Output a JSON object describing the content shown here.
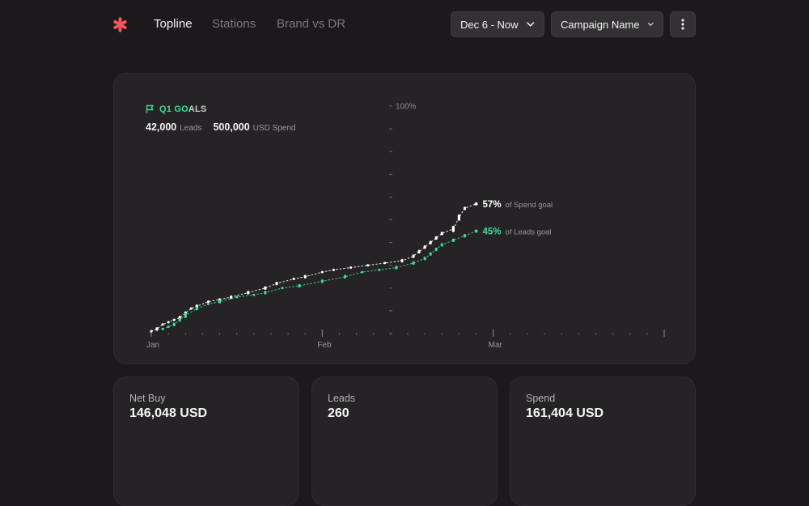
{
  "nav": {
    "tabs": [
      {
        "label": "Topline",
        "active": true
      },
      {
        "label": "Stations",
        "active": false
      },
      {
        "label": "Brand vs DR",
        "active": false
      }
    ],
    "date_range": "Dec 6 - Now",
    "campaign": "Campaign Name"
  },
  "colors": {
    "accent_red": "#f0565d",
    "leads_green": "#3ddc97",
    "spend_white": "#ffffff"
  },
  "goals": {
    "title_a": "Q1 GO",
    "title_b": "ALS",
    "leads_value": "42,000",
    "leads_unit": "Leads",
    "spend_value": "500,000",
    "spend_unit": "USD Spend"
  },
  "chart_data": {
    "type": "line",
    "title": "",
    "x_tick_labels": [
      "Jan",
      "Feb",
      "Mar"
    ],
    "y_tick_top_label": "100%",
    "ylim": [
      0,
      100
    ],
    "x_domain_days": [
      0,
      90
    ],
    "series": [
      {
        "key": "spend",
        "color": "#ffffff",
        "end_value_label": "57%",
        "end_text": "of Spend goal",
        "points": [
          [
            0,
            1
          ],
          [
            1,
            2
          ],
          [
            2,
            4
          ],
          [
            3,
            5
          ],
          [
            4,
            6
          ],
          [
            5,
            7
          ],
          [
            6,
            9
          ],
          [
            7,
            11
          ],
          [
            8,
            12
          ],
          [
            10,
            14
          ],
          [
            12,
            15
          ],
          [
            14,
            16
          ],
          [
            17,
            18
          ],
          [
            20,
            20
          ],
          [
            22,
            22
          ],
          [
            25,
            24
          ],
          [
            27,
            25
          ],
          [
            30,
            27
          ],
          [
            32,
            28
          ],
          [
            35,
            29
          ],
          [
            38,
            30
          ],
          [
            41,
            31
          ],
          [
            44,
            32
          ],
          [
            46,
            34
          ],
          [
            47,
            36
          ],
          [
            48,
            38
          ],
          [
            49,
            40
          ],
          [
            50,
            42
          ],
          [
            51,
            44
          ],
          [
            53,
            46
          ],
          [
            54,
            51
          ],
          [
            55,
            55
          ],
          [
            57,
            57
          ]
        ]
      },
      {
        "key": "leads",
        "color": "#3ddc97",
        "end_value_label": "45%",
        "end_text": "of Leads goal",
        "points": [
          [
            2,
            2
          ],
          [
            3,
            3
          ],
          [
            4,
            4
          ],
          [
            5,
            6
          ],
          [
            6,
            8
          ],
          [
            8,
            11
          ],
          [
            10,
            13
          ],
          [
            12,
            14
          ],
          [
            15,
            16
          ],
          [
            18,
            17
          ],
          [
            20,
            18
          ],
          [
            23,
            20
          ],
          [
            26,
            21
          ],
          [
            30,
            23
          ],
          [
            34,
            25
          ],
          [
            37,
            27
          ],
          [
            40,
            28
          ],
          [
            43,
            29
          ],
          [
            46,
            31
          ],
          [
            48,
            33
          ],
          [
            49,
            35
          ],
          [
            50,
            37
          ],
          [
            51,
            39
          ],
          [
            53,
            41
          ],
          [
            55,
            43
          ],
          [
            57,
            45
          ]
        ]
      }
    ]
  },
  "metrics": [
    {
      "label": "Net Buy",
      "value": "146,048 USD"
    },
    {
      "label": "Leads",
      "value": "260"
    },
    {
      "label": "Spend",
      "value": "161,404 USD"
    }
  ]
}
